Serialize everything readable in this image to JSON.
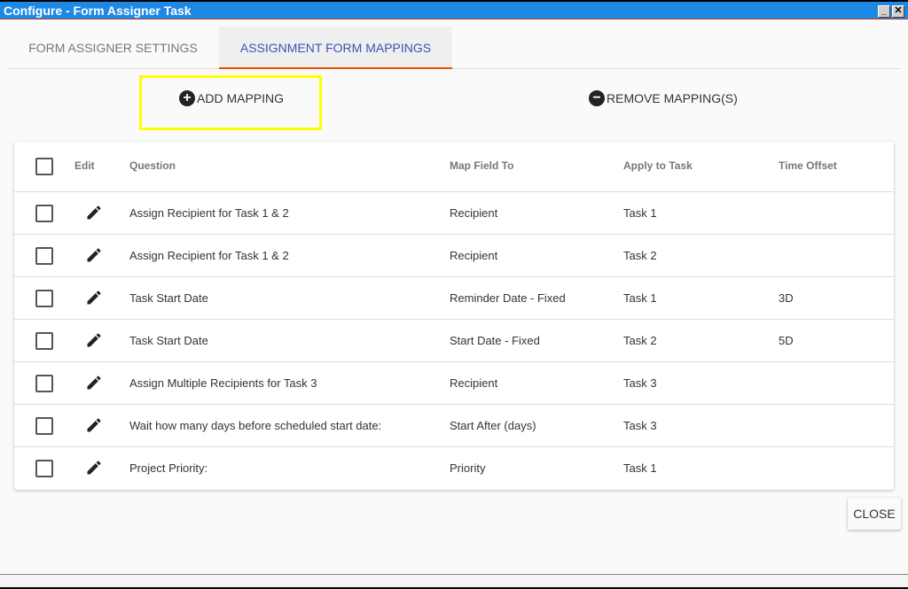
{
  "window": {
    "title": "Configure - Form Assigner Task",
    "minimize": "_",
    "close": "✕"
  },
  "tabs": [
    {
      "label": "FORM ASSIGNER SETTINGS"
    },
    {
      "label": "ASSIGNMENT FORM MAPPINGS"
    }
  ],
  "actions": {
    "add": "ADD MAPPING",
    "remove": "REMOVE MAPPING(S)"
  },
  "table": {
    "headers": {
      "edit": "Edit",
      "question": "Question",
      "map": "Map Field To",
      "task": "Apply to Task",
      "offset": "Time Offset"
    },
    "rows": [
      {
        "question": "Assign Recipient for Task 1 & 2",
        "map": "Recipient",
        "task": "Task 1",
        "offset": ""
      },
      {
        "question": "Assign Recipient for Task 1 & 2",
        "map": "Recipient",
        "task": "Task 2",
        "offset": ""
      },
      {
        "question": "Task Start Date",
        "map": "Reminder Date - Fixed",
        "task": "Task 1",
        "offset": "3D"
      },
      {
        "question": "Task Start Date",
        "map": "Start Date - Fixed",
        "task": "Task 2",
        "offset": "5D"
      },
      {
        "question": "Assign Multiple Recipients for Task 3",
        "map": "Recipient",
        "task": "Task 3",
        "offset": ""
      },
      {
        "question": "Wait how many days before scheduled start date:",
        "map": "Start After (days)",
        "task": "Task 3",
        "offset": ""
      },
      {
        "question": "Project Priority:",
        "map": "Priority",
        "task": "Task 1",
        "offset": ""
      }
    ]
  },
  "footer": {
    "close": "CLOSE"
  }
}
